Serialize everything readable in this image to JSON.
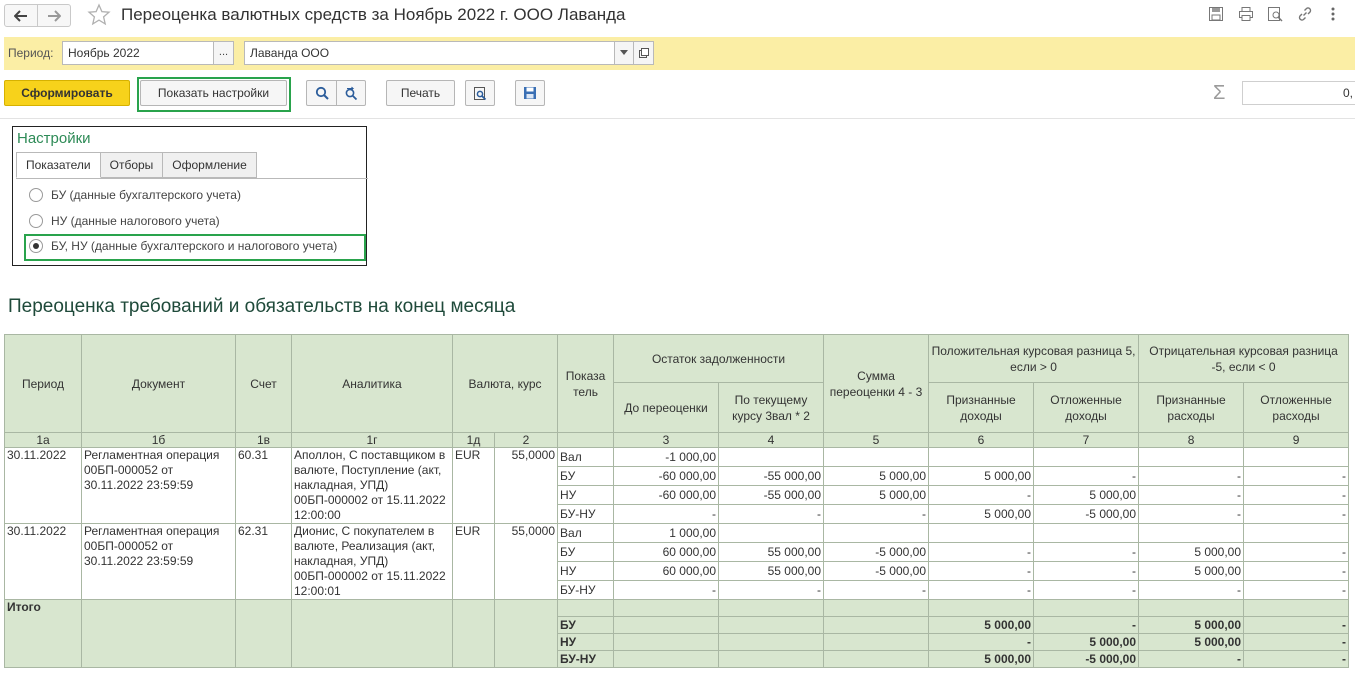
{
  "window": {
    "title": "Переоценка валютных средств за Ноябрь 2022 г. ООО Лаванда"
  },
  "params": {
    "period_label": "Период:",
    "period_value": "Ноябрь 2022",
    "period_select": "...",
    "org_value": "Лаванда ООО"
  },
  "toolbar": {
    "generate": "Сформировать",
    "show_settings": "Показать настройки",
    "print": "Печать",
    "sum_value": "0,"
  },
  "settings": {
    "title": "Настройки",
    "tabs": [
      "Показатели",
      "Отборы",
      "Оформление"
    ],
    "options": [
      "БУ (данные бухгалтерского учета)",
      "НУ (данные налогового учета)",
      "БУ, НУ (данные бухгалтерского и налогового учета)"
    ],
    "selected_option_index": 2
  },
  "report": {
    "title": "Переоценка требований и обязательств на конец месяца",
    "headers": {
      "period": "Период",
      "document": "Документ",
      "account": "Счет",
      "analytics": "Аналитика",
      "currency": "Валюта, курс",
      "indicator": "Показа тель",
      "balance": "Остаток задолженности",
      "before": "До переоценки",
      "current": "По текущему курсу 3вал * 2",
      "revaluation": "Сумма переоценки 4 - 3",
      "positive": "Положительная курсовая разница 5, если > 0",
      "negative": "Отрицательная курсовая разница -5, если < 0",
      "recognized_income": "Признанные доходы",
      "deferred_income": "Отложенные доходы",
      "recognized_expense": "Признанные расходы",
      "deferred_expense": "Отложенные расходы"
    },
    "col_numbers": [
      "1а",
      "1б",
      "1в",
      "1г",
      "1д",
      "2",
      "",
      "3",
      "4",
      "5",
      "6",
      "7",
      "8",
      "9"
    ],
    "groups": [
      {
        "period": "30.11.2022",
        "document": "Регламентная операция 00БП-000052 от 30.11.2022 23:59:59",
        "account": "60.31",
        "analytics": "Аполлон, С поставщиком в валюте, Поступление (акт, накладная, УПД) 00БП-000002 от 15.11.2022 12:00:00",
        "currency": "EUR",
        "rate": "55,0000",
        "rows": [
          {
            "ind": "Вал",
            "c3": "-1 000,00",
            "c4": "",
            "c5": "",
            "c6": "",
            "c7": "",
            "c8": "",
            "c9": ""
          },
          {
            "ind": "БУ",
            "c3": "-60 000,00",
            "c4": "-55 000,00",
            "c5": "5 000,00",
            "c6": "5 000,00",
            "c7": "-",
            "c8": "-",
            "c9": "-"
          },
          {
            "ind": "НУ",
            "c3": "-60 000,00",
            "c4": "-55 000,00",
            "c5": "5 000,00",
            "c6": "-",
            "c7": "5 000,00",
            "c8": "-",
            "c9": "-"
          },
          {
            "ind": "БУ-НУ",
            "c3": "-",
            "c4": "-",
            "c5": "-",
            "c6": "5 000,00",
            "c7": "-5 000,00",
            "c8": "-",
            "c9": "-"
          }
        ]
      },
      {
        "period": "30.11.2022",
        "document": "Регламентная операция 00БП-000052 от 30.11.2022 23:59:59",
        "account": "62.31",
        "analytics": "Дионис, С покупателем в валюте, Реализация (акт, накладная, УПД) 00БП-000002 от 15.11.2022 12:00:01",
        "currency": "EUR",
        "rate": "55,0000",
        "rows": [
          {
            "ind": "Вал",
            "c3": "1 000,00",
            "c4": "",
            "c5": "",
            "c6": "",
            "c7": "",
            "c8": "",
            "c9": ""
          },
          {
            "ind": "БУ",
            "c3": "60 000,00",
            "c4": "55 000,00",
            "c5": "-5 000,00",
            "c6": "-",
            "c7": "-",
            "c8": "5 000,00",
            "c9": "-"
          },
          {
            "ind": "НУ",
            "c3": "60 000,00",
            "c4": "55 000,00",
            "c5": "-5 000,00",
            "c6": "-",
            "c7": "-",
            "c8": "5 000,00",
            "c9": "-"
          },
          {
            "ind": "БУ-НУ",
            "c3": "-",
            "c4": "-",
            "c5": "-",
            "c6": "-",
            "c7": "-",
            "c8": "-",
            "c9": "-"
          }
        ]
      }
    ],
    "total": {
      "label": "Итого",
      "rows": [
        {
          "ind": "",
          "c3": "",
          "c4": "",
          "c5": "",
          "c6": "",
          "c7": "",
          "c8": "",
          "c9": ""
        },
        {
          "ind": "БУ",
          "c3": "",
          "c4": "",
          "c5": "",
          "c6": "5 000,00",
          "c7": "-",
          "c8": "5 000,00",
          "c9": "-"
        },
        {
          "ind": "НУ",
          "c3": "",
          "c4": "",
          "c5": "",
          "c6": "-",
          "c7": "5 000,00",
          "c8": "5 000,00",
          "c9": "-"
        },
        {
          "ind": "БУ-НУ",
          "c3": "",
          "c4": "",
          "c5": "",
          "c6": "5 000,00",
          "c7": "-5 000,00",
          "c8": "-",
          "c9": "-"
        }
      ]
    }
  }
}
